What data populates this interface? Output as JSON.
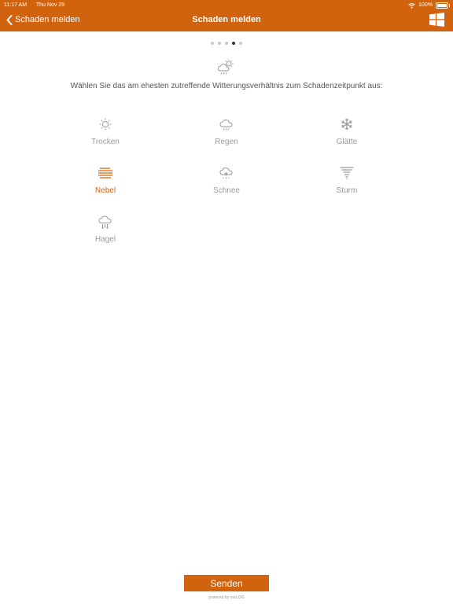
{
  "status_bar": {
    "time": "11:17 AM",
    "date": "Thu Nov 29",
    "battery": "100%"
  },
  "nav": {
    "back_label": "Schaden melden",
    "title": "Schaden melden"
  },
  "pager": {
    "total": 5,
    "current": 4
  },
  "instruction": "Wählen Sie das am ehesten zutreffende Witterungsverhältnis zum Schadenzeitpunkt aus:",
  "options": [
    {
      "label": "Trocken",
      "icon": "sun-icon"
    },
    {
      "label": "Regen",
      "icon": "rain-icon"
    },
    {
      "label": "Glätte",
      "icon": "snowflake-icon"
    },
    {
      "label": "Nebel",
      "icon": "fog-icon",
      "selected": true
    },
    {
      "label": "Schnee",
      "icon": "snow-cloud-icon"
    },
    {
      "label": "Sturm",
      "icon": "tornado-icon"
    },
    {
      "label": "Hagel",
      "icon": "hail-icon"
    }
  ],
  "send_label": "Senden",
  "footer": "powered by micLOG",
  "colors": {
    "accent": "#d2630e",
    "icon_grey": "#9a9a9a",
    "dot_active": "#333333",
    "dot_inactive": "#c8c8c8"
  }
}
